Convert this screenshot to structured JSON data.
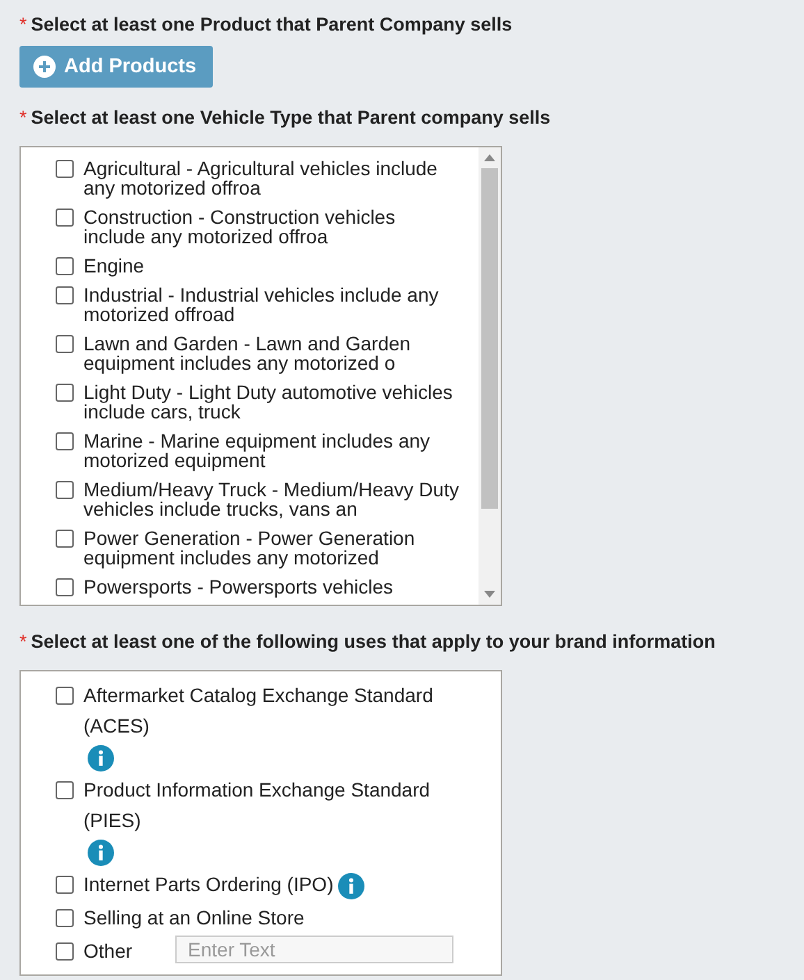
{
  "products_section": {
    "required_mark": "*",
    "label": "Select at least one Product that Parent Company sells",
    "button": "Add Products"
  },
  "vehicle_section": {
    "required_mark": "*",
    "label": "Select at least one Vehicle Type that Parent company sells",
    "items": [
      {
        "label": "Agricultural - Agricultural vehicles include any motorized offroa",
        "checked": false
      },
      {
        "label": "Construction - Construction vehicles include any motorized offroa",
        "checked": false
      },
      {
        "label": "Engine",
        "checked": false
      },
      {
        "label": "Industrial - Industrial vehicles include any motorized offroad",
        "checked": false
      },
      {
        "label": "Lawn and Garden - Lawn and Garden equipment includes any motorized o",
        "checked": false
      },
      {
        "label": "Light Duty - Light Duty automotive vehicles include cars, truck",
        "checked": false
      },
      {
        "label": "Marine - Marine equipment includes any motorized equipment",
        "checked": false
      },
      {
        "label": "Medium/Heavy Truck - Medium/Heavy Duty vehicles include trucks, vans an",
        "checked": false
      },
      {
        "label": "Power Generation - Power Generation equipment includes any motorized",
        "checked": false
      },
      {
        "label": "Powersports - Powersports vehicles",
        "checked": false
      }
    ]
  },
  "uses_section": {
    "required_mark": "*",
    "label": "Select at least one of the following uses that apply to your brand information",
    "items": [
      {
        "kind": "info",
        "label": "Aftermarket Catalog Exchange Standard (ACES)",
        "checked": false
      },
      {
        "kind": "info",
        "label": "Product Information Exchange Standard (PIES)",
        "checked": false
      },
      {
        "kind": "info",
        "label": "Internet Parts Ordering (IPO)",
        "checked": false
      },
      {
        "kind": "plain",
        "label": "Selling at an Online Store",
        "checked": false
      },
      {
        "kind": "other",
        "label": "Other",
        "checked": false,
        "placeholder": "Enter Text"
      }
    ]
  }
}
